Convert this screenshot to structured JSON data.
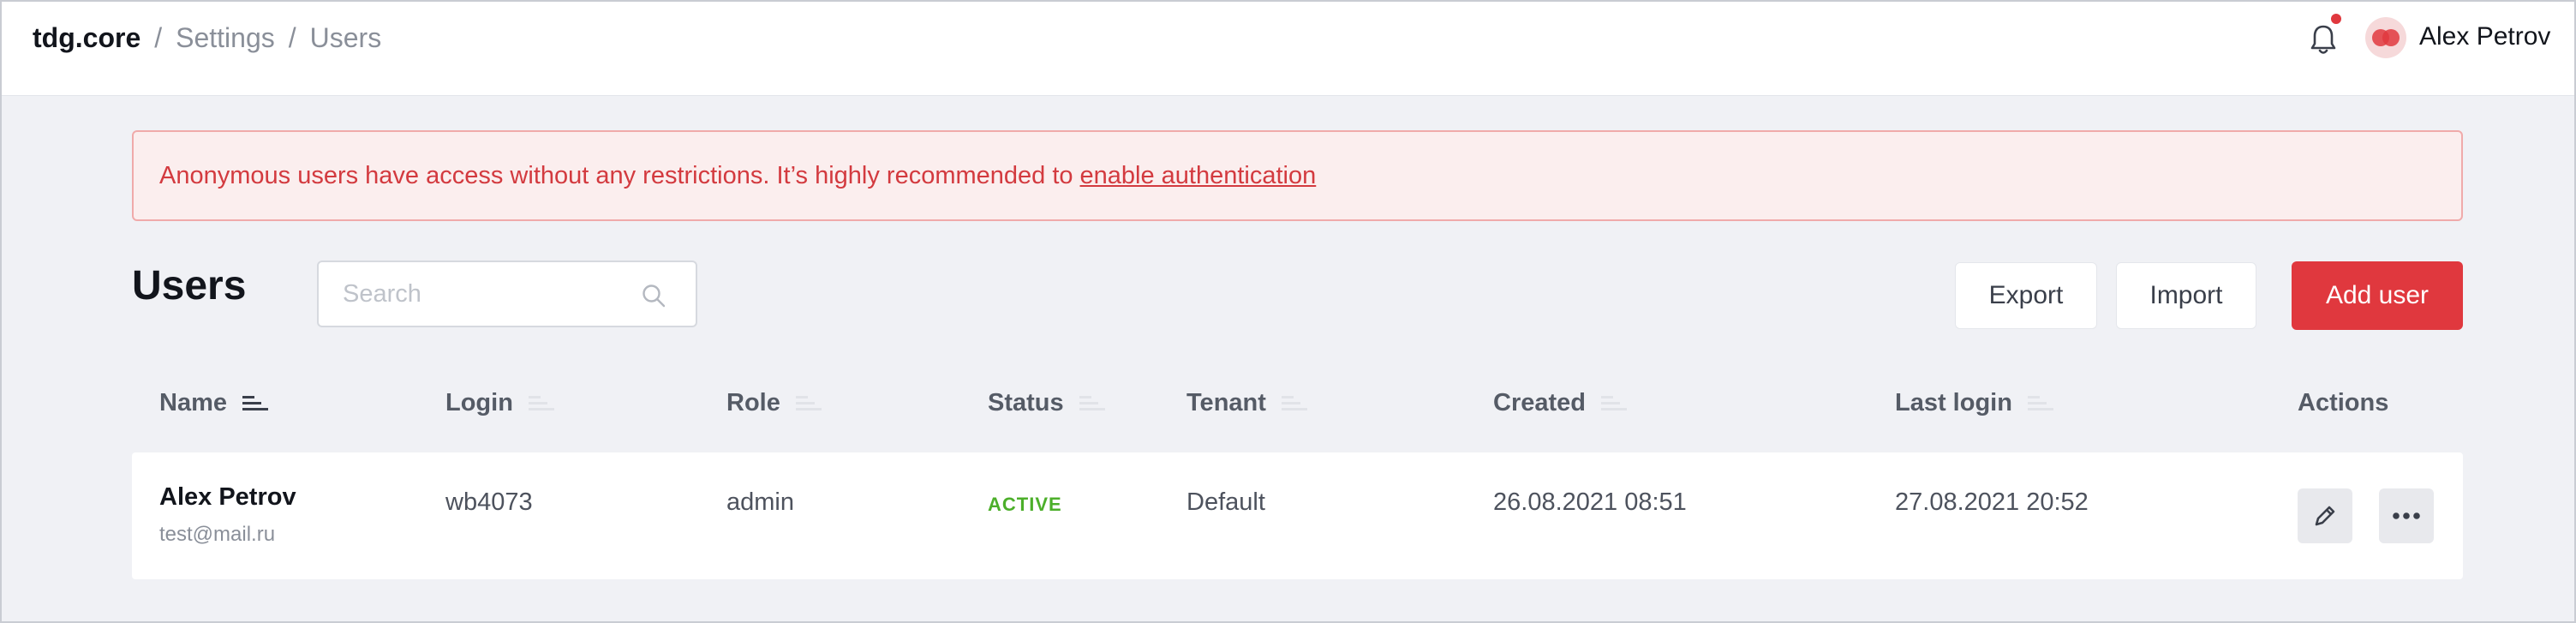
{
  "breadcrumb": {
    "root": "tdg.core",
    "separator": "/",
    "items": [
      "Settings",
      "Users"
    ]
  },
  "user": {
    "name": "Alex Petrov"
  },
  "alert": {
    "message": "Anonymous users have access without any restrictions. It’s highly recommended to",
    "link": "enable authentication"
  },
  "page": {
    "title": "Users"
  },
  "search": {
    "placeholder": "Search",
    "value": ""
  },
  "toolbar": {
    "export_label": "Export",
    "import_label": "Import",
    "add_label": "Add user"
  },
  "colors": {
    "accent": "#e0383e",
    "status_active": "#4caf2a",
    "background": "#f0f1f5"
  },
  "table": {
    "columns": [
      "Name",
      "Login",
      "Role",
      "Status",
      "Tenant",
      "Created",
      "Last login",
      "Actions"
    ],
    "rows": [
      {
        "name": "Alex Petrov",
        "email": "test@mail.ru",
        "login": "wb4073",
        "role": "admin",
        "status": "ACTIVE",
        "tenant": "Default",
        "created": "26.08.2021 08:51",
        "last_login": "27.08.2021 20:52"
      }
    ]
  },
  "icons": {
    "notification": "bell-icon",
    "avatar": "avatar-icon",
    "search": "search-icon",
    "sort": "sort-icon",
    "edit": "pencil-icon",
    "more": "more-icon"
  }
}
